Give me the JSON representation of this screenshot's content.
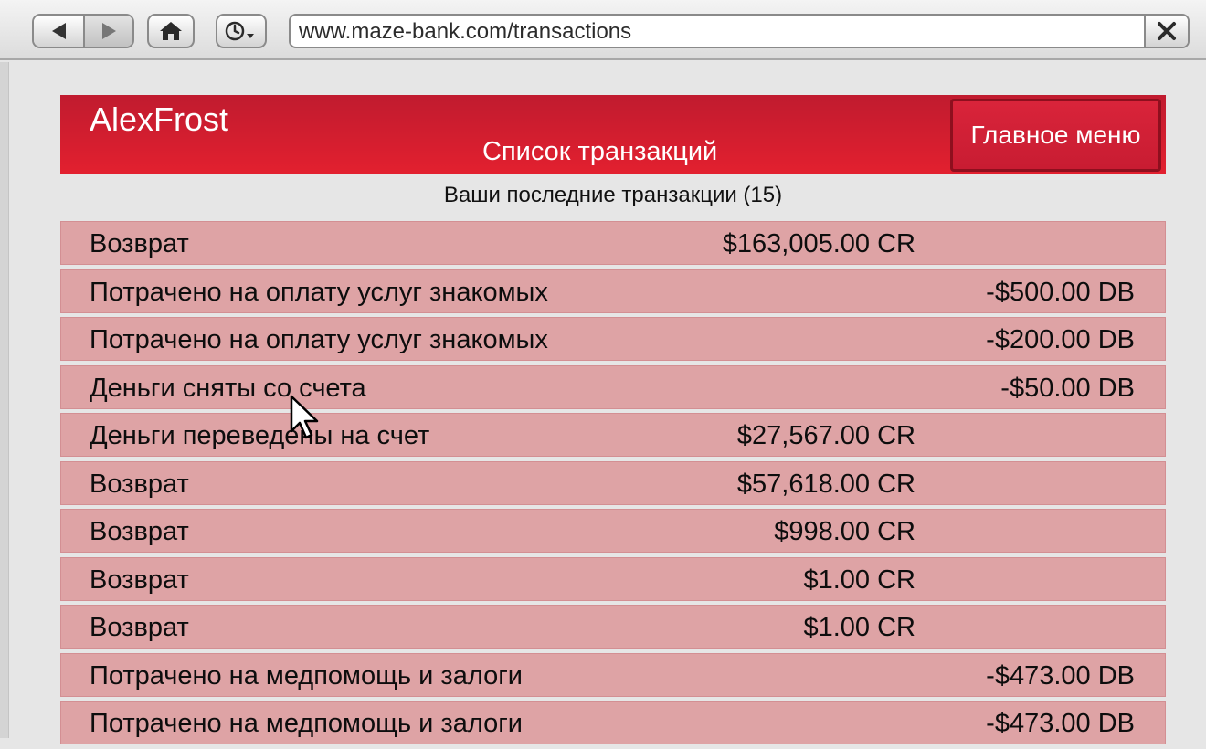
{
  "browser": {
    "url": "www.maze-bank.com/transactions"
  },
  "header": {
    "account_name": "AlexFrost",
    "subtitle": "Список транзакций",
    "main_menu_label": "Главное меню"
  },
  "summary": "Ваши последние транзакции (15)",
  "transactions": [
    {
      "description": "Возврат",
      "credit": "$163,005.00 CR",
      "debit": ""
    },
    {
      "description": "Потрачено на оплату услуг знакомых",
      "credit": "",
      "debit": "-$500.00 DB"
    },
    {
      "description": "Потрачено на оплату услуг знакомых",
      "credit": "",
      "debit": "-$200.00 DB"
    },
    {
      "description": "Деньги сняты со счета",
      "credit": "",
      "debit": "-$50.00 DB"
    },
    {
      "description": "Деньги переведены на счет",
      "credit": "$27,567.00 CR",
      "debit": ""
    },
    {
      "description": "Возврат",
      "credit": "$57,618.00 CR",
      "debit": ""
    },
    {
      "description": "Возврат",
      "credit": "$998.00 CR",
      "debit": ""
    },
    {
      "description": "Возврат",
      "credit": "$1.00 CR",
      "debit": ""
    },
    {
      "description": "Возврат",
      "credit": "$1.00 CR",
      "debit": ""
    },
    {
      "description": "Потрачено на медпомощь и залоги",
      "credit": "",
      "debit": "-$473.00 DB"
    },
    {
      "description": "Потрачено на медпомощь и залоги",
      "credit": "",
      "debit": "-$473.00 DB"
    }
  ],
  "colors": {
    "header_red": "#e3202f",
    "row_pink": "#dea3a5",
    "page_bg": "#e6e6e6"
  },
  "icons": {
    "back": "back-arrow-icon",
    "forward": "forward-arrow-icon",
    "home": "home-icon",
    "history": "clock-dropdown-icon",
    "close": "close-icon",
    "cursor": "mouse-pointer-icon"
  }
}
